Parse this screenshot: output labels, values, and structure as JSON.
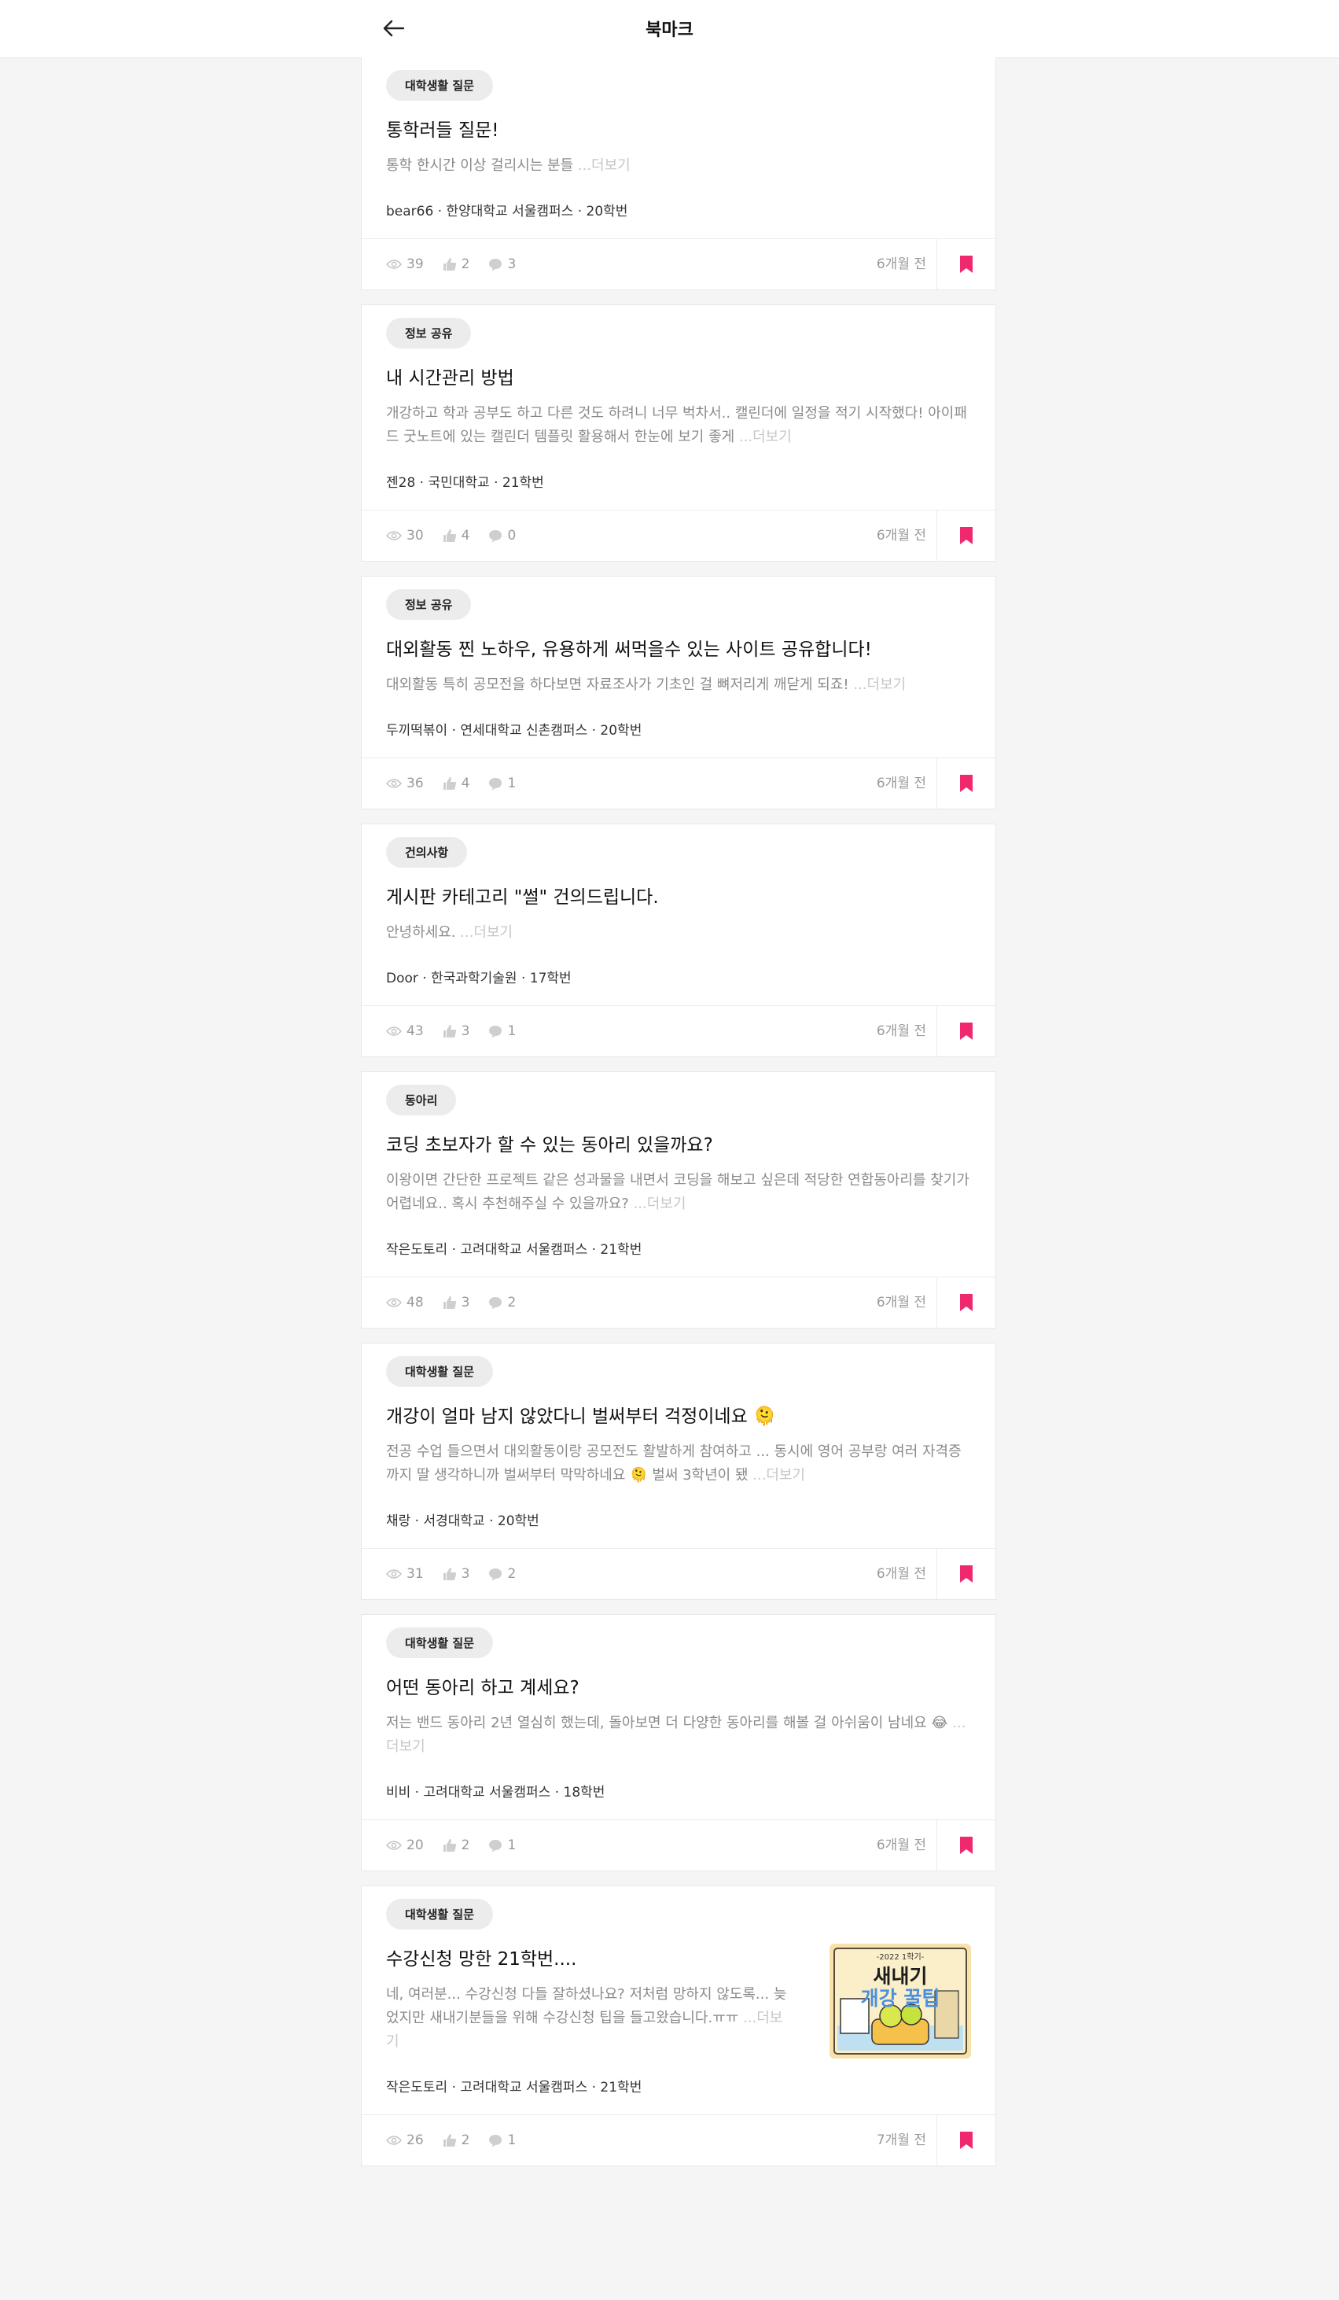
{
  "header": {
    "title": "북마크"
  },
  "colors": {
    "accent": "#f0286e",
    "muted": "#9a9a9a"
  },
  "more_label": "...더보기",
  "posts": [
    {
      "category": "대학생활 질문",
      "title": "통학러들 질문!",
      "excerpt": "통학 한시간 이상 걸리시는 분들 ",
      "author": "bear66 · 한양대학교 서울캠퍼스 · 20학번",
      "views": "39",
      "likes": "2",
      "comments": "3",
      "time": "6개월 전"
    },
    {
      "category": "정보 공유",
      "title": "내 시간관리 방법",
      "excerpt": "개강하고 학과 공부도 하고 다른 것도 하려니 너무 벅차서.. 캘린더에 일정을 적기 시작했다! 아이패드 굿노트에 있는 캘린더 템플릿 활용해서 한눈에 보기 좋게 ",
      "author": "젠28 · 국민대학교 · 21학번",
      "views": "30",
      "likes": "4",
      "comments": "0",
      "time": "6개월 전"
    },
    {
      "category": "정보 공유",
      "title": "대외활동 찐 노하우, 유용하게 써먹을수 있는 사이트 공유합니다!",
      "excerpt": "대외활동 특히 공모전을 하다보면 자료조사가 기초인 걸 뼈저리게 깨닫게 되죠! ",
      "author": "두끼떡볶이 · 연세대학교 신촌캠퍼스 · 20학번",
      "views": "36",
      "likes": "4",
      "comments": "1",
      "time": "6개월 전"
    },
    {
      "category": "건의사항",
      "title": "게시판 카테고리 \"썰\" 건의드립니다.",
      "excerpt": "안녕하세요. ",
      "author": "Door · 한국과학기술원 · 17학번",
      "views": "43",
      "likes": "3",
      "comments": "1",
      "time": "6개월 전"
    },
    {
      "category": "동아리",
      "title": "코딩 초보자가 할 수 있는 동아리 있을까요?",
      "excerpt": "이왕이면 간단한 프로젝트 같은 성과물을 내면서 코딩을 해보고 싶은데 적당한 연합동아리를 찾기가 어렵네요.. 혹시 추천해주실 수 있을까요? ",
      "author": "작은도토리 · 고려대학교 서울캠퍼스 · 21학번",
      "views": "48",
      "likes": "3",
      "comments": "2",
      "time": "6개월 전"
    },
    {
      "category": "대학생활 질문",
      "title": "개강이 얼마 남지 않았다니 벌써부터 걱정이네요 🫠",
      "excerpt": "전공 수업 들으면서 대외활동이랑 공모전도 활발하게 참여하고 ... 동시에 영어 공부랑 여러 자격증까지 딸 생각하니까 벌써부터 막막하네요 🫠 벌써 3학년이 됐 ",
      "author": "채랑 · 서경대학교 · 20학번",
      "views": "31",
      "likes": "3",
      "comments": "2",
      "time": "6개월 전"
    },
    {
      "category": "대학생활 질문",
      "title": "어떤 동아리 하고 계세요?",
      "excerpt": "저는 밴드 동아리 2년 열심히 했는데, 돌아보면 더 다양한 동아리를 해볼 걸 아쉬움이 남네요 😂 ",
      "author": "비비 · 고려대학교 서울캠퍼스 · 18학번",
      "views": "20",
      "likes": "2",
      "comments": "1",
      "time": "6개월 전"
    },
    {
      "category": "대학생활 질문",
      "title": "수강신청 망한 21학번....",
      "excerpt": "네, 여러분... 수강신청 다들 잘하셨나요? 저처럼 망하지 않도록... 늦었지만 새내기분들을 위해 수강신청 팁을 들고왔습니다.ㅠㅠ ",
      "author": "작은도토리 · 고려대학교 서울캠퍼스 · 21학번",
      "views": "26",
      "likes": "2",
      "comments": "1",
      "time": "7개월 전",
      "thumbnail": {
        "small": "-2022 1학기-",
        "line1": "새내기",
        "line2": "개강 꿀팁"
      }
    }
  ]
}
